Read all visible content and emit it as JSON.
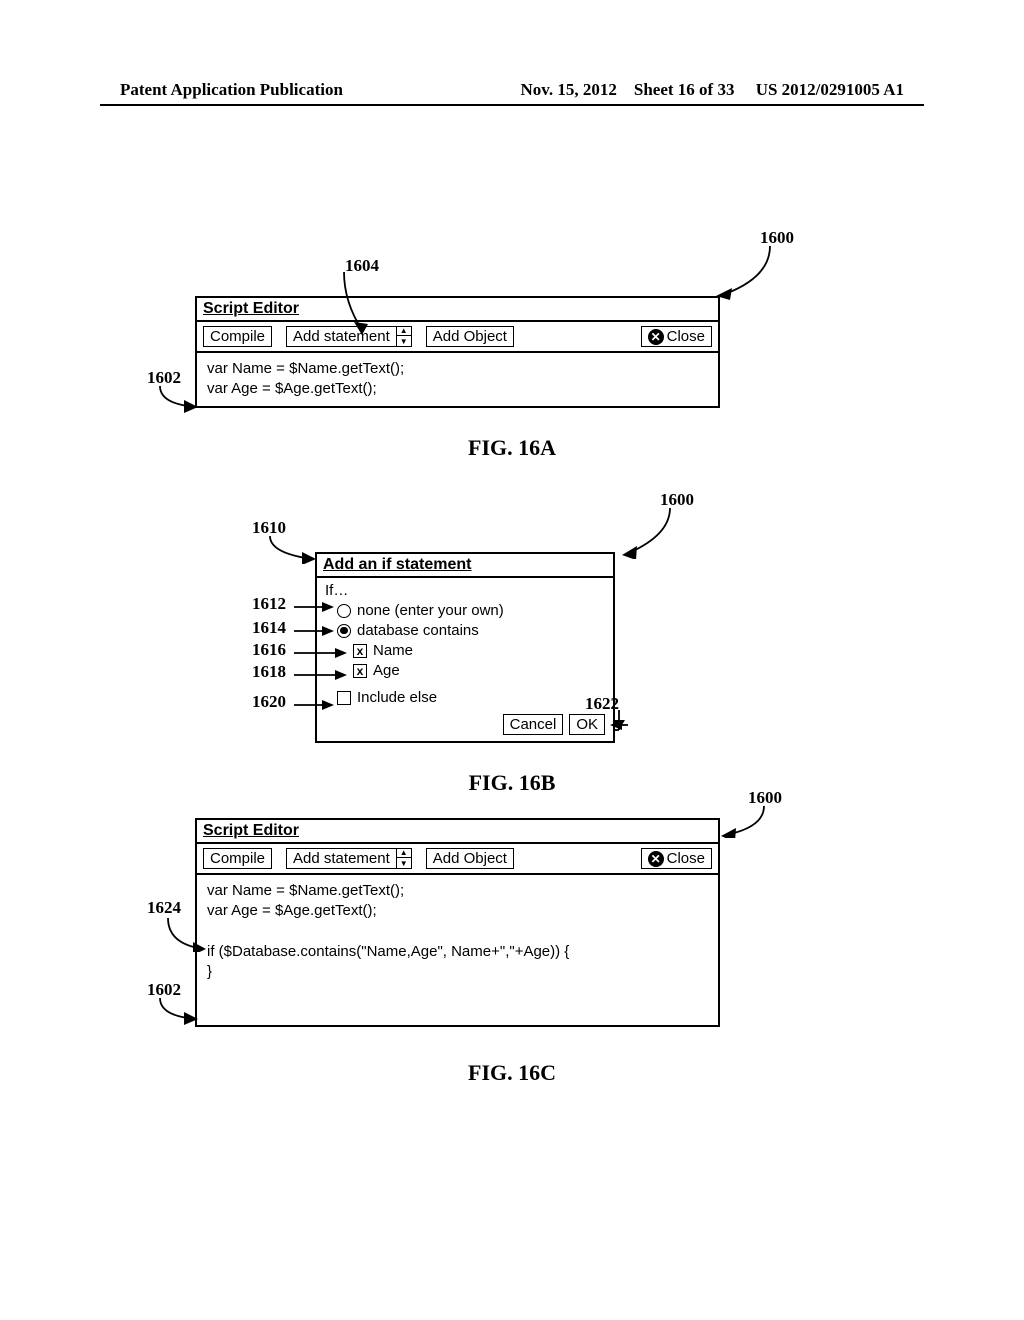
{
  "header": {
    "left": "Patent Application Publication",
    "date": "Nov. 15, 2012",
    "sheet": "Sheet 16 of 33",
    "pubno": "US 2012/0291005 A1"
  },
  "fig16a": {
    "title": "Script Editor",
    "compile": "Compile",
    "add_statement": "Add statement",
    "add_object": "Add Object",
    "close": "Close",
    "code": "var Name = $Name.getText();\nvar Age = $Age.getText();",
    "caption": "FIG. 16A",
    "ref_1600": "1600",
    "ref_1602": "1602",
    "ref_1604": "1604"
  },
  "fig16b": {
    "title": "Add an if statement",
    "if_label": "If…",
    "opt_none": "none (enter your own)",
    "opt_db": "database contains",
    "chk_name": "Name",
    "chk_age": "Age",
    "include_else": "Include else",
    "cancel": "Cancel",
    "ok": "OK",
    "caption": "FIG. 16B",
    "ref_1600": "1600",
    "ref_1610": "1610",
    "ref_1612": "1612",
    "ref_1614": "1614",
    "ref_1616": "1616",
    "ref_1618": "1618",
    "ref_1620": "1620",
    "ref_1622": "1622"
  },
  "fig16c": {
    "title": "Script Editor",
    "compile": "Compile",
    "add_statement": "Add statement",
    "add_object": "Add Object",
    "close": "Close",
    "code": "var Name = $Name.getText();\nvar Age = $Age.getText();\n\nif ($Database.contains(\"Name,Age\", Name+\",\"+Age)) {\n}",
    "caption": "FIG. 16C",
    "ref_1600": "1600",
    "ref_1602": "1602",
    "ref_1624": "1624"
  }
}
